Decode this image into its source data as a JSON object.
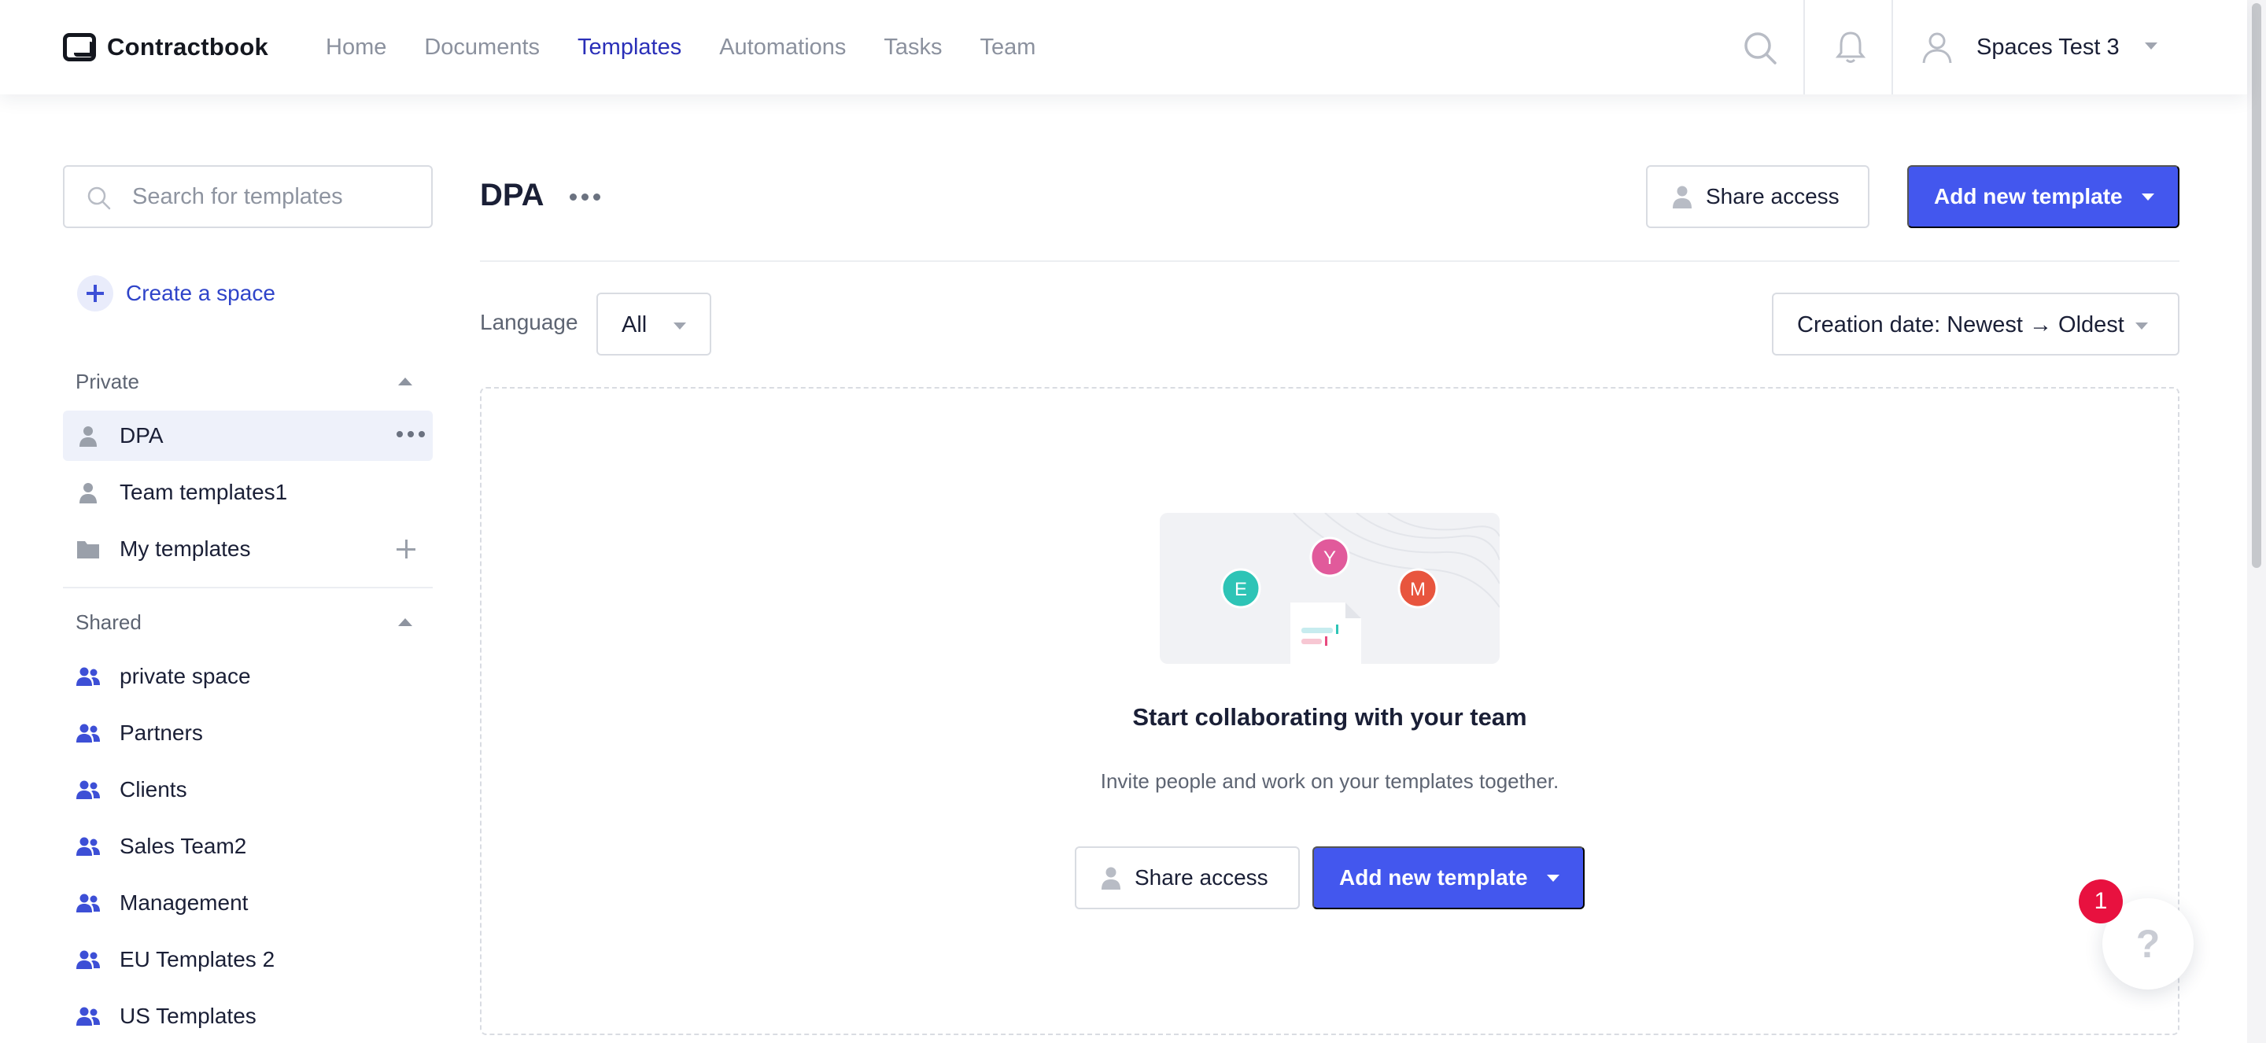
{
  "app": {
    "logo_text": "Contractbook"
  },
  "nav": {
    "items": [
      {
        "label": "Home",
        "active": false
      },
      {
        "label": "Documents",
        "active": false
      },
      {
        "label": "Templates",
        "active": true
      },
      {
        "label": "Automations",
        "active": false
      },
      {
        "label": "Tasks",
        "active": false
      },
      {
        "label": "Team",
        "active": false
      }
    ],
    "user_name": "Spaces Test 3"
  },
  "sidebar": {
    "search_placeholder": "Search for templates",
    "create_space_label": "Create a space",
    "private_heading": "Private",
    "private_items": [
      {
        "label": "DPA",
        "icon": "person-icon",
        "selected": true
      },
      {
        "label": "Team templates1",
        "icon": "person-icon",
        "selected": false
      },
      {
        "label": "My templates",
        "icon": "folder-icon",
        "selected": false
      }
    ],
    "shared_heading": "Shared",
    "shared_items": [
      {
        "label": "private space",
        "icon": "users-icon"
      },
      {
        "label": "Partners",
        "icon": "users-icon"
      },
      {
        "label": "Clients",
        "icon": "users-icon"
      },
      {
        "label": "Sales Team2",
        "icon": "users-icon"
      },
      {
        "label": "Management",
        "icon": "users-icon"
      },
      {
        "label": "EU Templates 2",
        "icon": "users-icon"
      },
      {
        "label": "US Templates",
        "icon": "users-icon"
      }
    ]
  },
  "main": {
    "title": "DPA",
    "share_access_label": "Share access",
    "add_template_label": "Add new template",
    "language_label": "Language",
    "language_value": "All",
    "sort_value": "Creation date: Newest → Oldest",
    "empty_state": {
      "avatars": [
        "E",
        "Y",
        "M"
      ],
      "title": "Start collaborating with your team",
      "subtitle": "Invite people and work on your templates together.",
      "share_access_label": "Share access",
      "add_template_label": "Add new template"
    }
  },
  "help": {
    "badge_count": "1",
    "icon_text": "?"
  },
  "colors": {
    "primary": "#4357ee",
    "active_nav": "#2a2fb8",
    "badge": "#e8113f"
  }
}
